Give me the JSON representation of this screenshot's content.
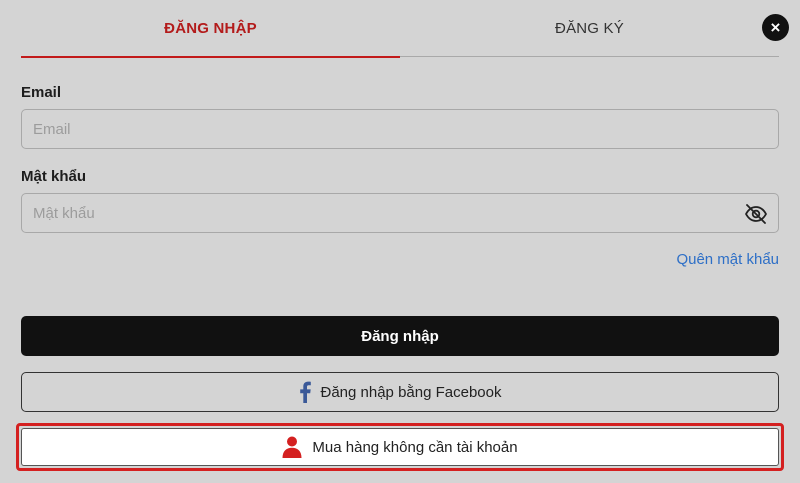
{
  "tabs": {
    "login_label": "ĐĂNG NHẬP",
    "register_label": "ĐĂNG KÝ",
    "active": "login"
  },
  "close": {
    "label": "×"
  },
  "form": {
    "email_label": "Email",
    "email_placeholder": "Email",
    "password_label": "Mật khẩu",
    "password_placeholder": "Mật khẩu",
    "forgot_label": "Quên mật khẩu"
  },
  "buttons": {
    "login_label": "Đăng nhập",
    "facebook_label": "Đăng nhập bằng Facebook",
    "guest_label": "Mua hàng không cần tài khoản"
  },
  "icons": {
    "close": "close-icon",
    "eye": "eye-slash-icon",
    "facebook": "facebook-icon",
    "user": "user-icon"
  },
  "colors": {
    "accent": "#c21a1a",
    "link": "#2d6fc7",
    "primary_button": "#111111",
    "facebook": "#3b5998",
    "highlight_border": "#d42020"
  }
}
